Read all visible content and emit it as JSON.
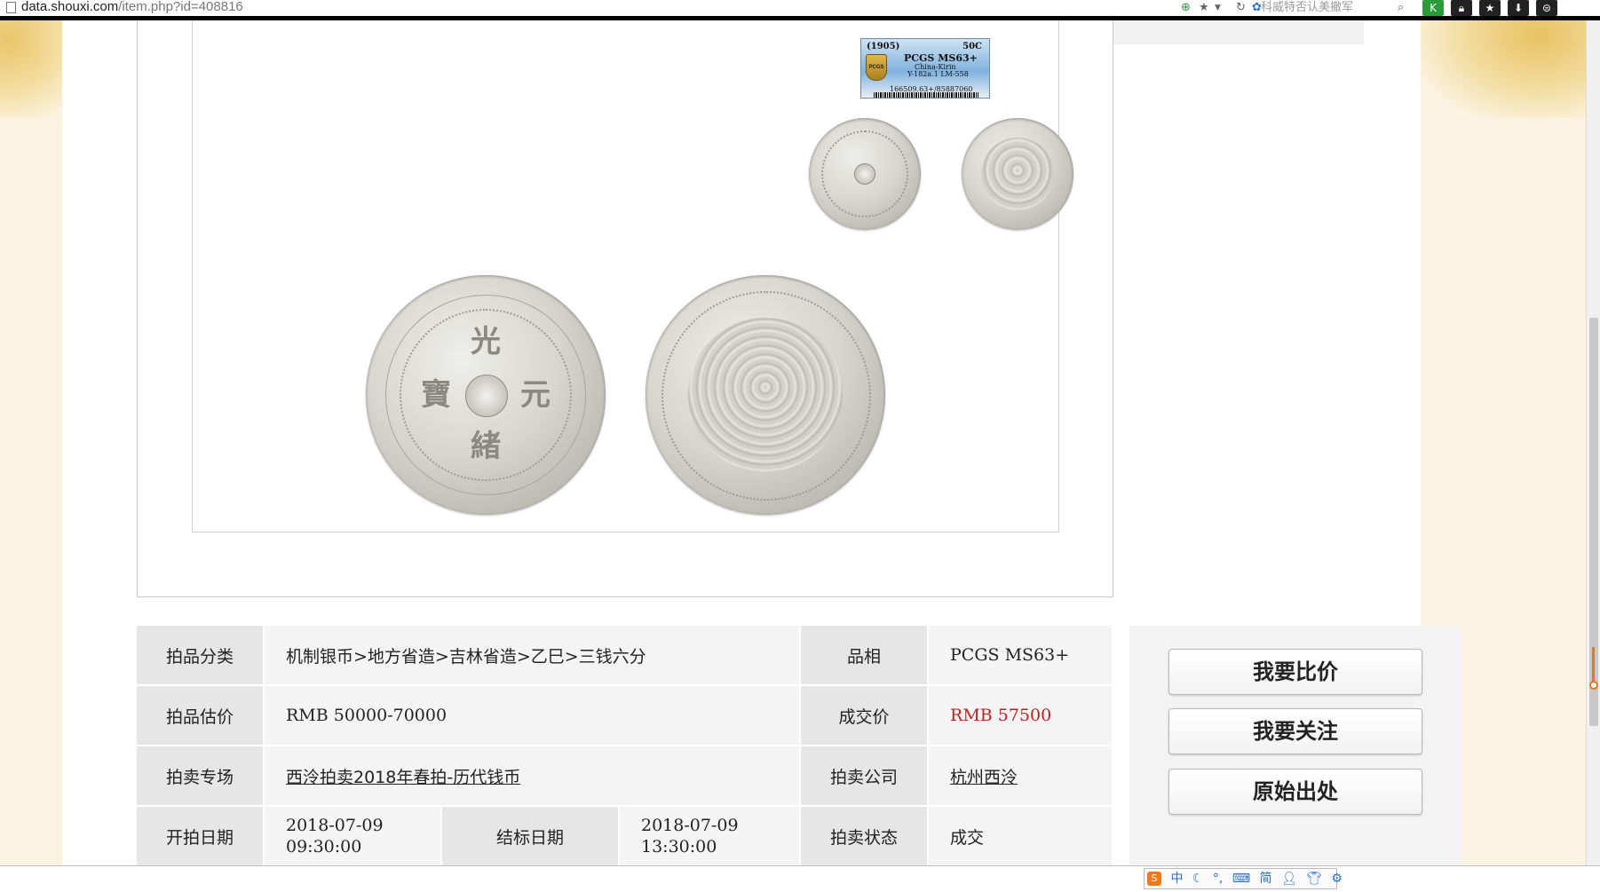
{
  "browser": {
    "url_domain": "data.shouxi.com",
    "url_path": "/item.php?id=408816",
    "search_placeholder": "科威特否认美撤军"
  },
  "pcgs_label": {
    "year": "(1905)",
    "denomination": "50C",
    "grade": "PCGS MS63+",
    "region": "China-Kirin",
    "catalog": "Y-182a.1 LM-558",
    "cert": "166509.63+/85887060",
    "logo_text": "PCGS"
  },
  "coin_obverse": {
    "chars": [
      "光",
      "寶",
      "元",
      "緒"
    ]
  },
  "info": {
    "category_label": "拍品分类",
    "category_value": "机制银币>地方省造>吉林省造>乙巳>三钱六分",
    "grade_label": "品相",
    "grade_value": "PCGS MS63+",
    "estimate_label": "拍品估价",
    "estimate_value": "RMB 50000-70000",
    "price_label": "成交价",
    "price_value": "RMB 57500",
    "session_label": "拍卖专场",
    "session_value": "西泠拍卖2018年春拍-历代钱币",
    "company_label": "拍卖公司",
    "company_value": "杭州西泠",
    "start_label": "开拍日期",
    "start_date": "2018-07-09",
    "start_time": "09:30:00",
    "end_label": "结标日期",
    "end_date": "2018-07-09",
    "end_time": "13:30:00",
    "status_label": "拍卖状态",
    "status_value": "成交",
    "price_color": "#c01e1e"
  },
  "actions": {
    "compare": "我要比价",
    "follow": "我要关注",
    "source": "原始出处"
  },
  "ime": {
    "logo": "S",
    "lang": "中",
    "simplified": "简"
  }
}
